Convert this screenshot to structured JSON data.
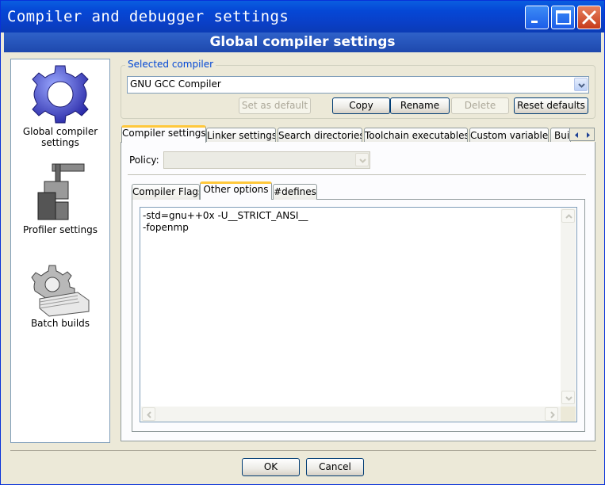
{
  "window": {
    "title": "Compiler and debugger settings",
    "controls": [
      "minimize-icon",
      "maximize-icon",
      "close-icon"
    ]
  },
  "header": {
    "title": "Global compiler settings"
  },
  "sidebar": {
    "items": [
      {
        "label": "Global compiler settings",
        "icon": "gear-icon",
        "selected": true
      },
      {
        "label": "Profiler settings",
        "icon": "profiler-icon"
      },
      {
        "label": "Batch builds",
        "icon": "batch-builds-icon"
      }
    ]
  },
  "selected_compiler": {
    "group_label": "Selected compiler",
    "value": "GNU GCC Compiler",
    "buttons": {
      "set_default": "Set as default",
      "copy": "Copy",
      "rename": "Rename",
      "delete": "Delete",
      "reset_defaults": "Reset defaults"
    }
  },
  "tabs": [
    {
      "label": "Compiler settings",
      "active": true
    },
    {
      "label": "Linker settings"
    },
    {
      "label": "Search directories"
    },
    {
      "label": "Toolchain executables"
    },
    {
      "label": "Custom variables"
    },
    {
      "label": "Bui"
    }
  ],
  "policy": {
    "label": "Policy:",
    "value": ""
  },
  "subtabs": [
    {
      "label": "Compiler Flags"
    },
    {
      "label": "Other options",
      "active": true
    },
    {
      "label": "#defines"
    }
  ],
  "other_options": {
    "lines": [
      "-std=gnu++0x -U__STRICT_ANSI__",
      "-fopenmp"
    ]
  },
  "dialog_buttons": {
    "ok": "OK",
    "cancel": "Cancel"
  }
}
